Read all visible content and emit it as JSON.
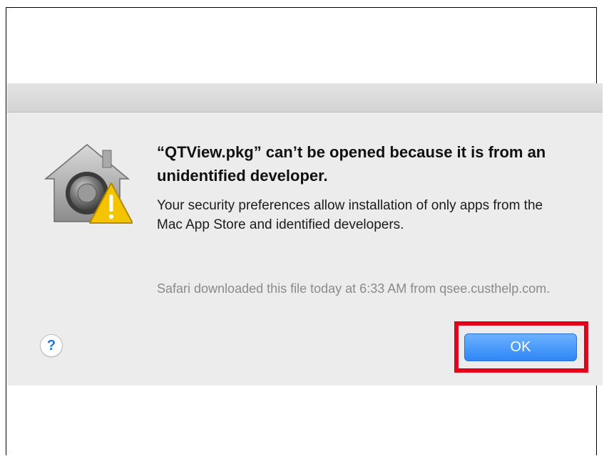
{
  "dialog": {
    "headline": "“QTView.pkg” can’t be opened because it is from an unidentified developer.",
    "message": "Your security preferences allow installation of only apps from the Mac App Store and identified developers.",
    "source_note": "Safari downloaded this file today at 6:33 AM from qsee.custhelp.com.",
    "help_label": "?",
    "ok_label": "OK",
    "icon": "gatekeeper-security-icon",
    "warning_icon": "warning-triangle-icon"
  },
  "colors": {
    "dialog_background": "#ececec",
    "ok_button": "#2f86f6",
    "help_glyph": "#1e74e8",
    "highlight_border": "#e3001b",
    "warning": "#f4c400"
  }
}
